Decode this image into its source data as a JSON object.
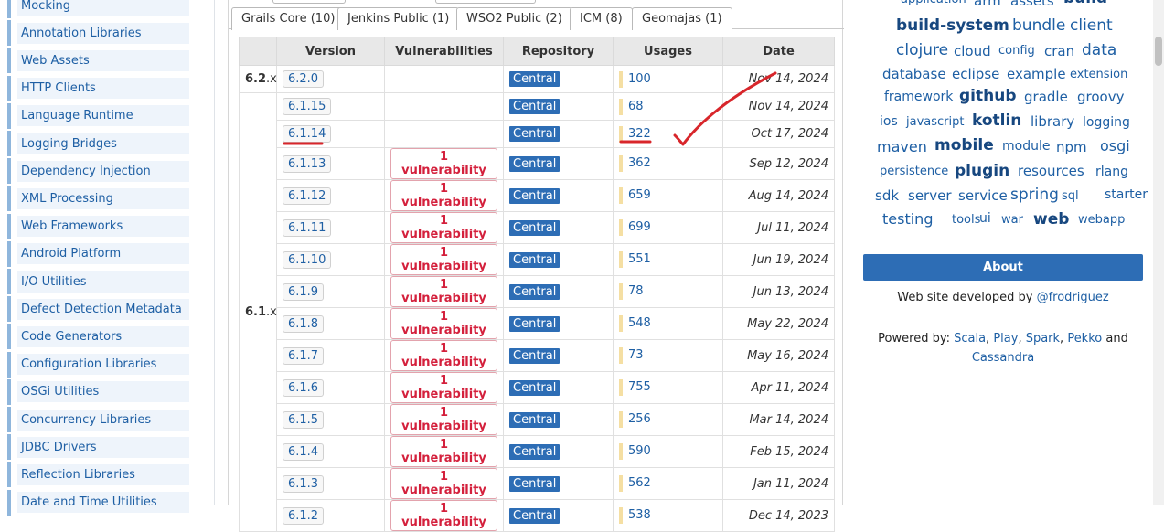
{
  "sidebar": {
    "items": [
      {
        "label": "Mocking"
      },
      {
        "label": "Annotation Libraries"
      },
      {
        "label": "Web Assets"
      },
      {
        "label": "HTTP Clients"
      },
      {
        "label": "Language Runtime"
      },
      {
        "label": "Logging Bridges"
      },
      {
        "label": "Dependency Injection"
      },
      {
        "label": "XML Processing"
      },
      {
        "label": "Web Frameworks"
      },
      {
        "label": "Android Platform"
      },
      {
        "label": "I/O Utilities"
      },
      {
        "label": "Defect Detection Metadata"
      },
      {
        "label": "Code Generators"
      },
      {
        "label": "Configuration Libraries"
      },
      {
        "label": "OSGi Utilities"
      },
      {
        "label": "Concurrency Libraries"
      },
      {
        "label": "JDBC Drivers"
      },
      {
        "label": "Reflection Libraries"
      },
      {
        "label": "Date and Time Utilities"
      }
    ]
  },
  "tabs": [
    {
      "label": "Grails Core (10)"
    },
    {
      "label": "Jenkins Public (1)"
    },
    {
      "label": "WSO2 Public (2)"
    },
    {
      "label": "ICM (8)"
    },
    {
      "label": "Geomajas (1)"
    }
  ],
  "table": {
    "headers": [
      "Version",
      "Vulnerabilities",
      "Repository",
      "Usages",
      "Date"
    ],
    "groups": [
      {
        "major": "6.2",
        "suffix": ".x"
      },
      {
        "major": "6.1",
        "suffix": ".x"
      }
    ],
    "rows": [
      {
        "version": "6.2.0",
        "vuln": "",
        "repo": "Central",
        "usages": "100",
        "date": "Nov 14, 2024"
      },
      {
        "version": "6.1.15",
        "vuln": "",
        "repo": "Central",
        "usages": "68",
        "date": "Nov 14, 2024"
      },
      {
        "version": "6.1.14",
        "vuln": "",
        "repo": "Central",
        "usages": "322",
        "date": "Oct 17, 2024"
      },
      {
        "version": "6.1.13",
        "vuln": "1 vulnerability",
        "repo": "Central",
        "usages": "362",
        "date": "Sep 12, 2024"
      },
      {
        "version": "6.1.12",
        "vuln": "1 vulnerability",
        "repo": "Central",
        "usages": "659",
        "date": "Aug 14, 2024"
      },
      {
        "version": "6.1.11",
        "vuln": "1 vulnerability",
        "repo": "Central",
        "usages": "699",
        "date": "Jul 11, 2024"
      },
      {
        "version": "6.1.10",
        "vuln": "1 vulnerability",
        "repo": "Central",
        "usages": "551",
        "date": "Jun 19, 2024"
      },
      {
        "version": "6.1.9",
        "vuln": "1 vulnerability",
        "repo": "Central",
        "usages": "78",
        "date": "Jun 13, 2024"
      },
      {
        "version": "6.1.8",
        "vuln": "1 vulnerability",
        "repo": "Central",
        "usages": "548",
        "date": "May 22, 2024"
      },
      {
        "version": "6.1.7",
        "vuln": "1 vulnerability",
        "repo": "Central",
        "usages": "73",
        "date": "May 16, 2024"
      },
      {
        "version": "6.1.6",
        "vuln": "1 vulnerability",
        "repo": "Central",
        "usages": "755",
        "date": "Apr 11, 2024"
      },
      {
        "version": "6.1.5",
        "vuln": "1 vulnerability",
        "repo": "Central",
        "usages": "256",
        "date": "Mar 14, 2024"
      },
      {
        "version": "6.1.4",
        "vuln": "1 vulnerability",
        "repo": "Central",
        "usages": "590",
        "date": "Feb 15, 2024"
      },
      {
        "version": "6.1.3",
        "vuln": "1 vulnerability",
        "repo": "Central",
        "usages": "562",
        "date": "Jan 11, 2024"
      },
      {
        "version": "6.1.2",
        "vuln": "1 vulnerability",
        "repo": "Central",
        "usages": "538",
        "date": "Dec 14, 2023"
      }
    ]
  },
  "tag_cloud": [
    {
      "label": "application",
      "bold": false
    },
    {
      "label": "arm",
      "bold": false
    },
    {
      "label": "assets",
      "bold": false
    },
    {
      "label": "build",
      "bold": true
    },
    {
      "label": "build-system",
      "bold": true
    },
    {
      "label": "bundle",
      "bold": false
    },
    {
      "label": "client",
      "bold": false
    },
    {
      "label": "clojure",
      "bold": false
    },
    {
      "label": "cloud",
      "bold": false
    },
    {
      "label": "config",
      "bold": false
    },
    {
      "label": "cran",
      "bold": false
    },
    {
      "label": "data",
      "bold": false
    },
    {
      "label": "database",
      "bold": false
    },
    {
      "label": "eclipse",
      "bold": false
    },
    {
      "label": "example",
      "bold": false
    },
    {
      "label": "extension",
      "bold": false
    },
    {
      "label": "framework",
      "bold": false
    },
    {
      "label": "github",
      "bold": true
    },
    {
      "label": "gradle",
      "bold": false
    },
    {
      "label": "groovy",
      "bold": false
    },
    {
      "label": "ios",
      "bold": false
    },
    {
      "label": "javascript",
      "bold": false
    },
    {
      "label": "kotlin",
      "bold": true
    },
    {
      "label": "library",
      "bold": false
    },
    {
      "label": "logging",
      "bold": false
    },
    {
      "label": "maven",
      "bold": false
    },
    {
      "label": "mobile",
      "bold": true
    },
    {
      "label": "module",
      "bold": false
    },
    {
      "label": "npm",
      "bold": false
    },
    {
      "label": "osgi",
      "bold": false
    },
    {
      "label": "persistence",
      "bold": false
    },
    {
      "label": "plugin",
      "bold": true
    },
    {
      "label": "resources",
      "bold": false
    },
    {
      "label": "rlang",
      "bold": false
    },
    {
      "label": "sdk",
      "bold": false
    },
    {
      "label": "server",
      "bold": false
    },
    {
      "label": "service",
      "bold": false
    },
    {
      "label": "spring",
      "bold": false
    },
    {
      "label": "sql",
      "bold": false
    },
    {
      "label": "starter",
      "bold": false
    },
    {
      "label": "testing",
      "bold": false
    },
    {
      "label": "tools",
      "bold": false
    },
    {
      "label": "ui",
      "bold": false
    },
    {
      "label": "war",
      "bold": false
    },
    {
      "label": "web",
      "bold": true
    },
    {
      "label": "webapp",
      "bold": false
    }
  ],
  "about": {
    "button_label": "About",
    "dev_text": "Web site developed by ",
    "dev_link": "@frodriguez",
    "powered_text": "Powered by: ",
    "powered_links": [
      "Scala",
      "Play",
      "Spark",
      "Pekko",
      "Cassandra"
    ],
    "sep1": ", ",
    "sep_and": " and "
  },
  "colors": {
    "link": "#1e5fa4",
    "repo_badge": "#2d6db5",
    "vuln_text": "#d4203c",
    "annotation": "#d8262b"
  }
}
